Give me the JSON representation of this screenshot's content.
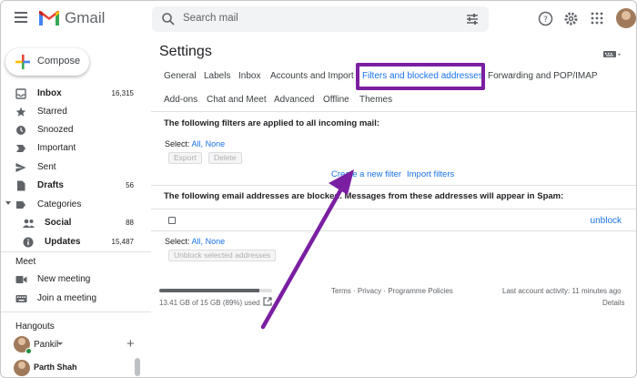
{
  "header": {
    "app_name": "Gmail",
    "search_placeholder": "Search mail"
  },
  "sidebar": {
    "compose_label": "Compose",
    "items": [
      {
        "label": "Inbox",
        "count": "16,315",
        "icon": "inbox-icon",
        "bold": true
      },
      {
        "label": "Starred",
        "count": "",
        "icon": "star-icon"
      },
      {
        "label": "Snoozed",
        "count": "",
        "icon": "clock-icon"
      },
      {
        "label": "Important",
        "count": "",
        "icon": "label-important-icon"
      },
      {
        "label": "Sent",
        "count": "",
        "icon": "send-icon"
      },
      {
        "label": "Drafts",
        "count": "56",
        "icon": "draft-icon",
        "bold": true
      },
      {
        "label": "Categories",
        "count": "",
        "icon": "label-icon"
      },
      {
        "label": "Social",
        "count": "88",
        "icon": "people-icon",
        "bold": true
      },
      {
        "label": "Updates",
        "count": "15,487",
        "icon": "info-icon",
        "bold": true
      }
    ],
    "meet": {
      "title": "Meet",
      "new_meeting": "New meeting",
      "join_meeting": "Join a meeting"
    },
    "hangouts": {
      "title": "Hangouts",
      "current_user": "Pankil",
      "contact": "Parth Shah"
    }
  },
  "settings": {
    "title": "Settings",
    "tabs_row1": [
      "General",
      "Labels",
      "Inbox",
      "Accounts and Import",
      "Filters and blocked addresses",
      "Forwarding and POP/IMAP"
    ],
    "tabs_row2": [
      "Add-ons",
      "Chat and Meet",
      "Advanced",
      "Offline",
      "Themes"
    ],
    "active_tab": "Filters and blocked addresses",
    "filters_heading": "The following filters are applied to all incoming mail:",
    "select_label": "Select:",
    "select_all": "All",
    "select_none": "None",
    "comma": ",",
    "export_label": "Export",
    "delete_label": "Delete",
    "create_filter": "Create a new filter",
    "import_filters": "Import filters",
    "blocked_heading": "The following email addresses are blocked. Messages from these addresses will appear in Spam:",
    "unblock_label": "unblock",
    "unblock_selected": "Unblock selected addresses"
  },
  "footer": {
    "storage": "13.41 GB of 15 GB (89%) used",
    "storage_fraction": 0.89,
    "links": "Terms · Privacy · Programme Policies",
    "activity": "Last account activity: 11 minutes ago",
    "details": "Details"
  },
  "colors": {
    "highlight": "#7b1fa2",
    "arrow": "#7b1fa2",
    "link": "#1a73e8"
  }
}
